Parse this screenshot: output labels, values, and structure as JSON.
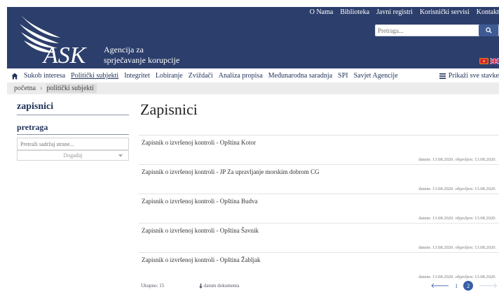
{
  "brand": {
    "logo_text": "ASK",
    "subtitle_line1": "Agencija za",
    "subtitle_line2": "sprječavanje korupcije",
    "color": "#2c3e6b"
  },
  "topnav": [
    "O Nama",
    "Biblioteka",
    "Javni registri",
    "Korisnički servisi",
    "Kontakt"
  ],
  "search": {
    "placeholder": "Pretraga...",
    "icon": "search-icon"
  },
  "flags": [
    "montenegro-flag-icon",
    "uk-flag-icon"
  ],
  "mainnav": {
    "items": [
      "Sukob interesa",
      "Politički subjekti",
      "Integritet",
      "Lobiranje",
      "Zviždači",
      "Analiza propisa",
      "Međunarodna saradnja",
      "SPI",
      "Savjet Agencije"
    ],
    "active_index": 1,
    "show_all": "Prikaži sve stavke"
  },
  "breadcrumb": [
    "početna",
    "politički subjekti"
  ],
  "sidebar": {
    "title": "zapisnici",
    "subtitle": "pretraga",
    "search_placeholder": "Pretraži sadržaj strane...",
    "select_value": "Događaj"
  },
  "content": {
    "title": "Zapisnici",
    "records": [
      {
        "title": "Zapisnik o izvršenoj kontroli - Opština Kotor",
        "meta": "datum: 13.08.2020. objavljen: 13.08.2020."
      },
      {
        "title": "Zapisnik o izvršenoj kontroli - JP Za upravljanje morskim dobrom CG",
        "meta": "datum: 13.08.2020. objavljen: 13.08.2020."
      },
      {
        "title": "Zapisnik o izvršenoj kontroli - Opština Budva",
        "meta": "datum: 13.08.2020. objavljen: 13.08.2020."
      },
      {
        "title": "Zapisnik o izvršenoj kontroli - Opština Šavnik",
        "meta": "datum: 13.08.2020. objavljen: 13.08.2020."
      },
      {
        "title": "Zapisnik o izvršenoj kontroli - Opština Žabljak",
        "meta": "datum: 13.08.2020. objavljen: 13.08.2020."
      }
    ]
  },
  "footer": {
    "total": "Ukupno: 15",
    "sort_label": "datum dokumenta",
    "pages": [
      "1",
      "2"
    ],
    "current_page": "2"
  }
}
